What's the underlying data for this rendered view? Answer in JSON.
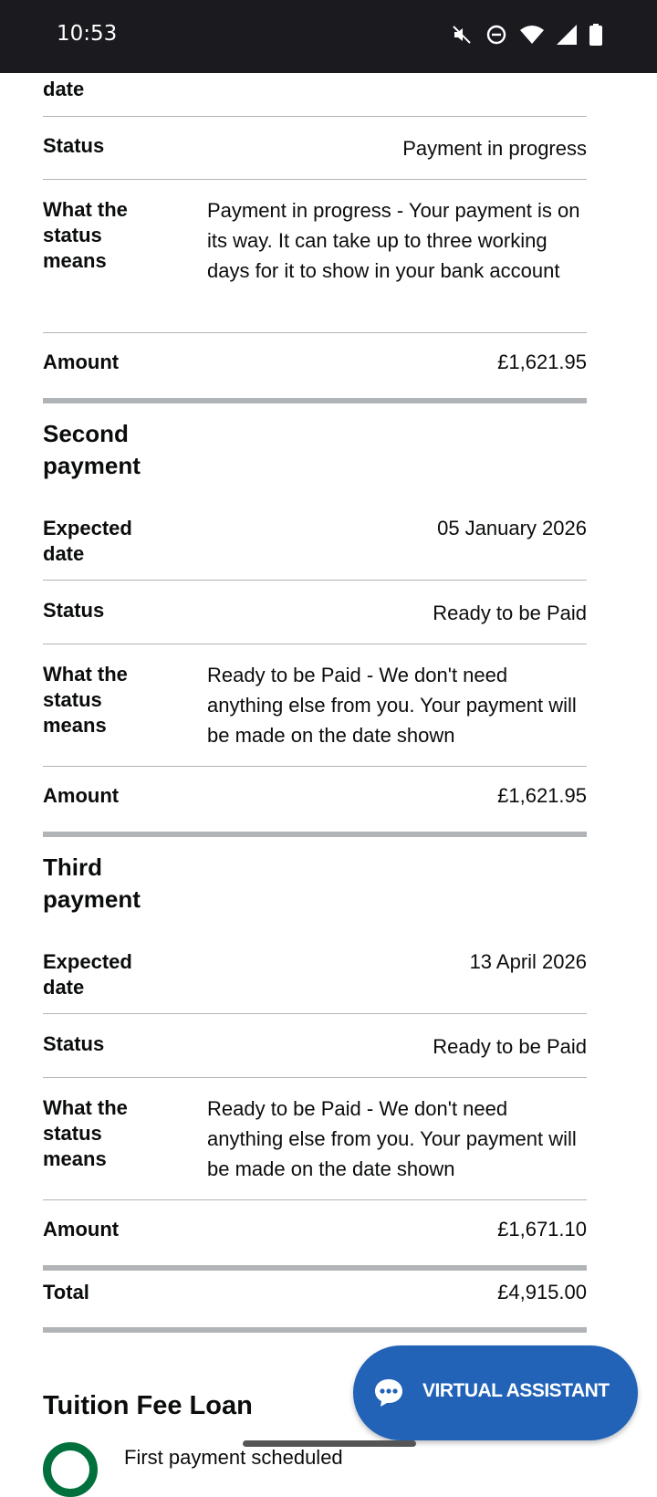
{
  "status_bar": {
    "time": "10:53",
    "icons": [
      "mute-icon",
      "do-not-disturb-icon",
      "wifi-icon",
      "signal-icon",
      "battery-icon"
    ]
  },
  "first_payment": {
    "expected_date_label_partial": "date",
    "status_label": "Status",
    "status_value": "Payment in progress",
    "meaning_label": "What the status means",
    "meaning_value": "Payment in progress - Your payment is on its way. It can take up to three working days for it to show in your bank account",
    "amount_label": "Amount",
    "amount_value": "£1,621.95"
  },
  "second_payment": {
    "heading": "Second payment",
    "expected_date_label": "Expected date",
    "expected_date_value": "05 January 2026",
    "status_label": "Status",
    "status_value": "Ready to be Paid",
    "meaning_label": "What the status means",
    "meaning_value": "Ready to be Paid - We don't need anything else from you. Your payment will be made on the date shown",
    "amount_label": "Amount",
    "amount_value": "£1,621.95"
  },
  "third_payment": {
    "heading": "Third payment",
    "expected_date_label": "Expected date",
    "expected_date_value": "13 April 2026",
    "status_label": "Status",
    "status_value": "Ready to be Paid",
    "meaning_label": "What the status means",
    "meaning_value": "Ready to be Paid - We don't need anything else from you. Your payment will be made on the date shown",
    "amount_label": "Amount",
    "amount_value": "£1,671.10"
  },
  "total": {
    "label": "Total",
    "value": "£4,915.00"
  },
  "tuition_fee_loan": {
    "heading": "Tuition Fee Loan",
    "first_item": "First payment scheduled"
  },
  "virtual_assistant": {
    "label": "VIRTUAL ASSISTANT",
    "color": "#2263b8"
  }
}
